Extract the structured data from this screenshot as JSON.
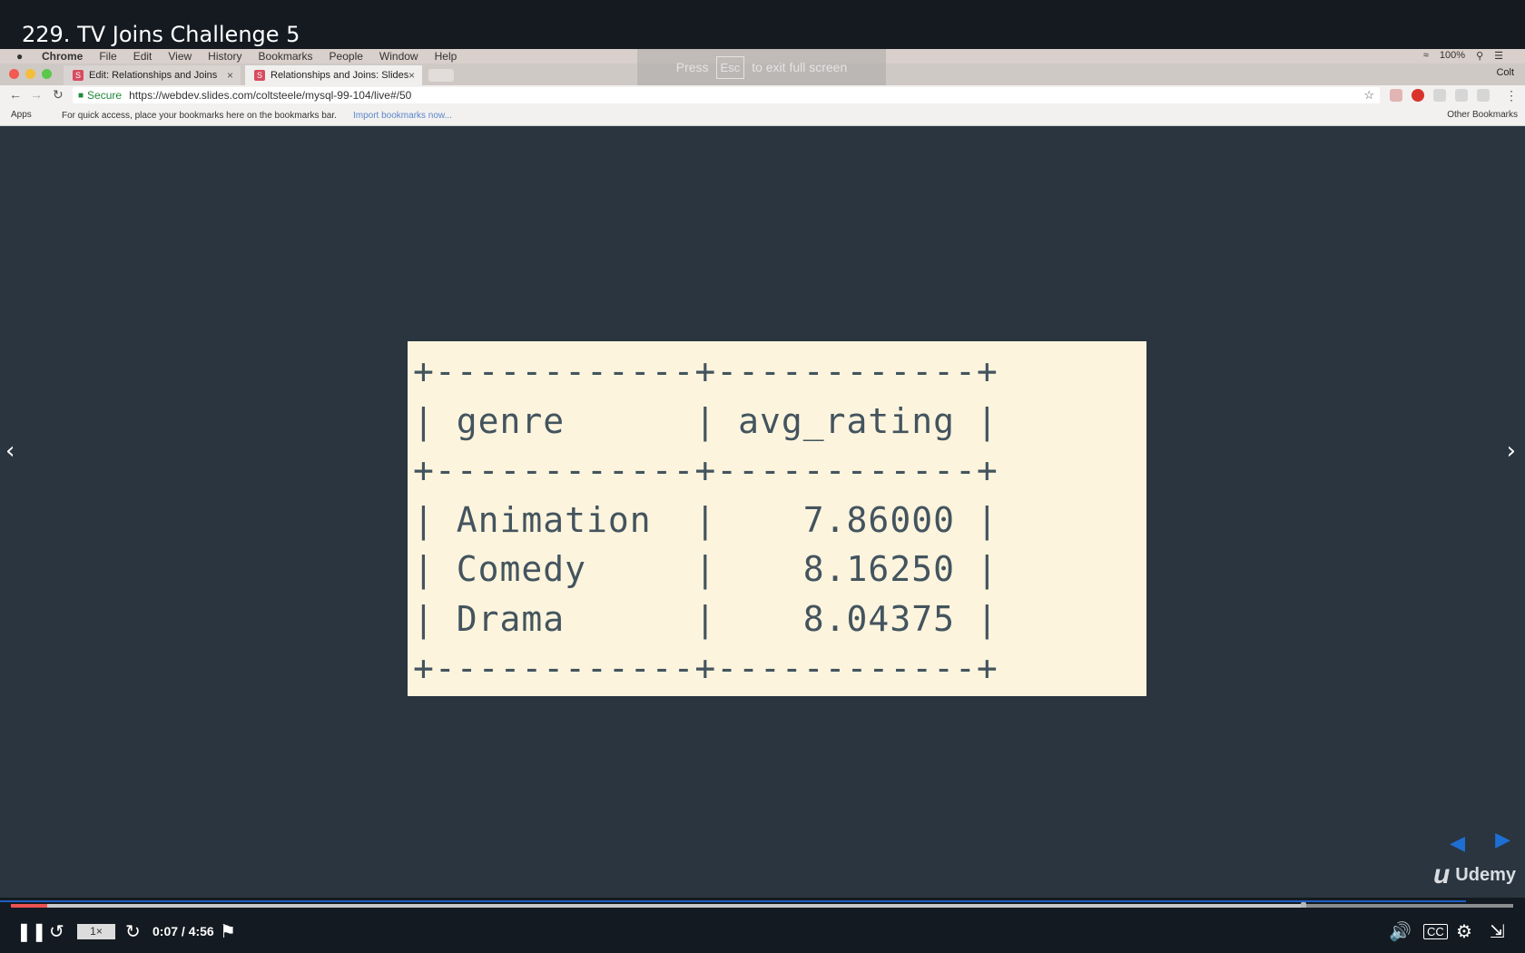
{
  "lecture": {
    "title": "229. TV Joins Challenge 5"
  },
  "mac_menu": {
    "apple": "",
    "items": [
      "Chrome",
      "File",
      "Edit",
      "View",
      "History",
      "Bookmarks",
      "People",
      "Window",
      "Help"
    ],
    "battery": "100%"
  },
  "browser": {
    "tabs": [
      {
        "label": "Edit: Relationships and Joins",
        "active": false
      },
      {
        "label": "Relationships and Joins: Slides",
        "active": true
      }
    ],
    "profile": "Colt",
    "secure_label": "Secure",
    "url": "https://webdev.slides.com/coltsteele/mysql-99-104/live#/50",
    "bookmarks": {
      "apps": "Apps",
      "hint": "For quick access, place your bookmarks here on the bookmarks bar.",
      "import": "Import bookmarks now...",
      "other": "Other Bookmarks"
    },
    "fullscreen_notice": {
      "pre": "Press",
      "key": "Esc",
      "post": "to exit full screen"
    }
  },
  "slide": {
    "border_top": "+------------+------------+",
    "header_row": "| genre      | avg_rating |",
    "border_mid": "+------------+------------+",
    "rows": [
      "| Animation  |    7.86000 |",
      "| Comedy     |    8.16250 |",
      "| Drama      |    8.04375 |"
    ],
    "border_bottom": "+------------+------------+",
    "table": {
      "columns": [
        "genre",
        "avg_rating"
      ],
      "data": [
        [
          "Animation",
          "7.86000"
        ],
        [
          "Comedy",
          "8.16250"
        ],
        [
          "Drama",
          "8.04375"
        ]
      ]
    }
  },
  "branding": {
    "logo_text": "Udemy"
  },
  "player": {
    "speed": "1×",
    "time": "0:07 / 4:56",
    "progress_fraction": 0.024,
    "icons": [
      "pause-icon",
      "rewind-icon",
      "forward-icon",
      "bookmark-icon",
      "volume-icon",
      "cc-icon",
      "settings-icon",
      "exit-fullscreen-icon"
    ]
  },
  "colors": {
    "accent_red": "#ec5252",
    "slide_bg": "#fcf4dd",
    "slide_text": "#43545e",
    "video_bg": "#2a3540"
  }
}
